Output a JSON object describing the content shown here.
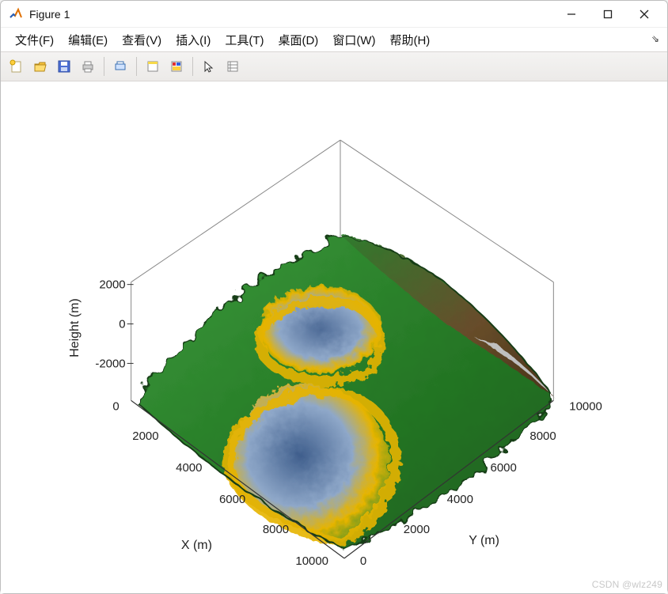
{
  "window": {
    "title": "Figure 1"
  },
  "menus": {
    "file": "文件(F)",
    "edit": "编辑(E)",
    "view": "查看(V)",
    "insert": "插入(I)",
    "tools": "工具(T)",
    "desktop": "桌面(D)",
    "window": "窗口(W)",
    "help": "帮助(H)"
  },
  "toolbar_icons": [
    "new",
    "open",
    "save",
    "print",
    "sep",
    "print-preview",
    "sep",
    "window-layout",
    "colorbar",
    "sep",
    "pointer",
    "inspector"
  ],
  "watermark": "CSDN @wlz249",
  "chart_data": {
    "type": "surface",
    "title": "",
    "zlabel": "Height (m)",
    "xlabel": "X (m)",
    "ylabel": "Y (m)",
    "x_range": [
      0,
      10000
    ],
    "y_range": [
      0,
      10000
    ],
    "z_range": [
      -3000,
      3000
    ],
    "x_ticks": [
      0,
      2000,
      4000,
      6000,
      8000,
      10000
    ],
    "y_ticks": [
      0,
      2000,
      4000,
      6000,
      8000,
      10000
    ],
    "z_ticks": [
      -2000,
      0,
      2000
    ],
    "colormap": [
      "#5b7aa8",
      "#a8c0dc",
      "#e6b400",
      "#2e8b2e",
      "#1e6b1e",
      "#6b4a2a"
    ],
    "colormap_meaning": "blue=low valleys, yellow=transition shoreline band, green=mid-to-high plateau, brown=specific slope/shadowed region",
    "description": "3D terrain surface over a 10 km × 10 km domain. Heights span roughly −3000 m to +3000 m. There are two depressed basins (blue, below 0 m) centered approximately around (6000, 5000) and a larger irregular basin around (5000, 2000)–(8000, 1000), separated and surrounded by a green plateau (~0 to 2000 m). Narrow yellow bands mark the ~0 m contour between basin and plateau. The far corner near (10000, 10000) and the ridge along high-X/high-Y side shows brownish shading.",
    "approx_height_samples": [
      {
        "x": 0,
        "y": 0,
        "z": 1200
      },
      {
        "x": 0,
        "y": 5000,
        "z": 1000
      },
      {
        "x": 0,
        "y": 10000,
        "z": 1400
      },
      {
        "x": 5000,
        "y": 0,
        "z": -1500
      },
      {
        "x": 5000,
        "y": 5000,
        "z": -800
      },
      {
        "x": 6000,
        "y": 6000,
        "z": -1400
      },
      {
        "x": 5000,
        "y": 10000,
        "z": 1600
      },
      {
        "x": 10000,
        "y": 0,
        "z": -900
      },
      {
        "x": 10000,
        "y": 5000,
        "z": 800
      },
      {
        "x": 10000,
        "y": 10000,
        "z": 1500
      },
      {
        "x": 8000,
        "y": 2000,
        "z": -2300
      },
      {
        "x": 3000,
        "y": 7000,
        "z": 1300
      }
    ]
  }
}
